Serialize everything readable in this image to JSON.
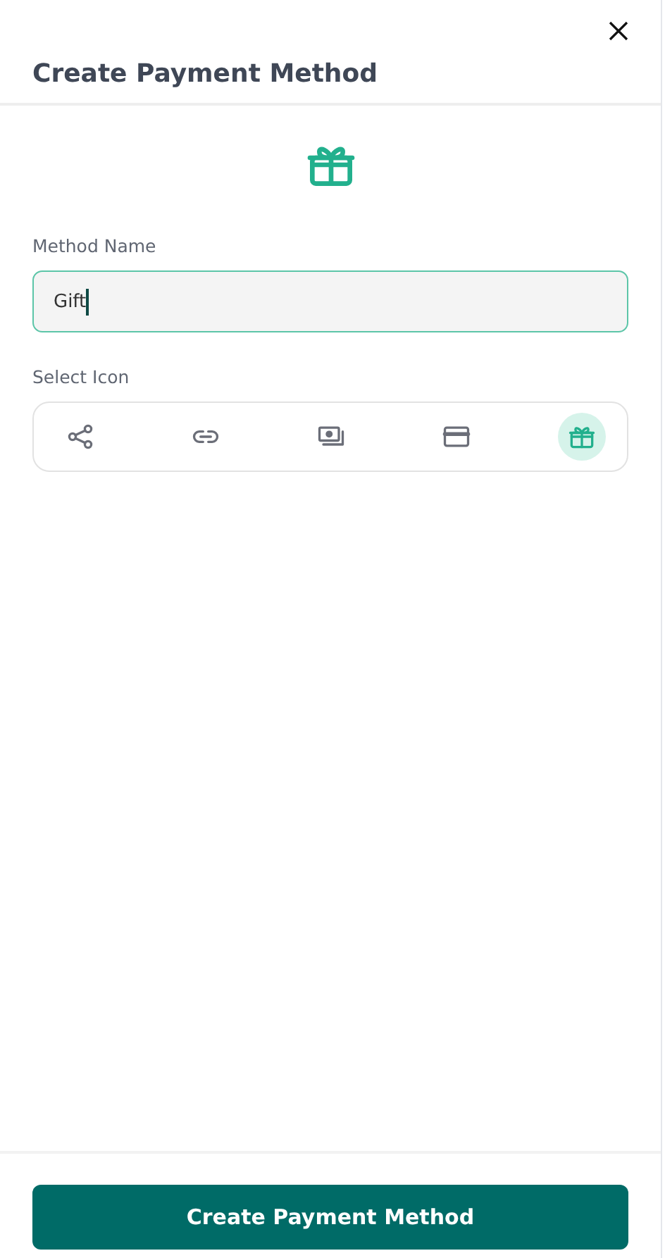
{
  "title": "Create Payment Method",
  "name_field": {
    "label": "Method Name",
    "value": "Gift"
  },
  "icon_picker": {
    "label": "Select Icon",
    "icons": [
      {
        "kind": "share",
        "selected": false
      },
      {
        "kind": "link",
        "selected": false
      },
      {
        "kind": "cash",
        "selected": false
      },
      {
        "kind": "card",
        "selected": false
      },
      {
        "kind": "gift",
        "selected": true
      }
    ]
  },
  "submit_button": "Create Payment Method"
}
